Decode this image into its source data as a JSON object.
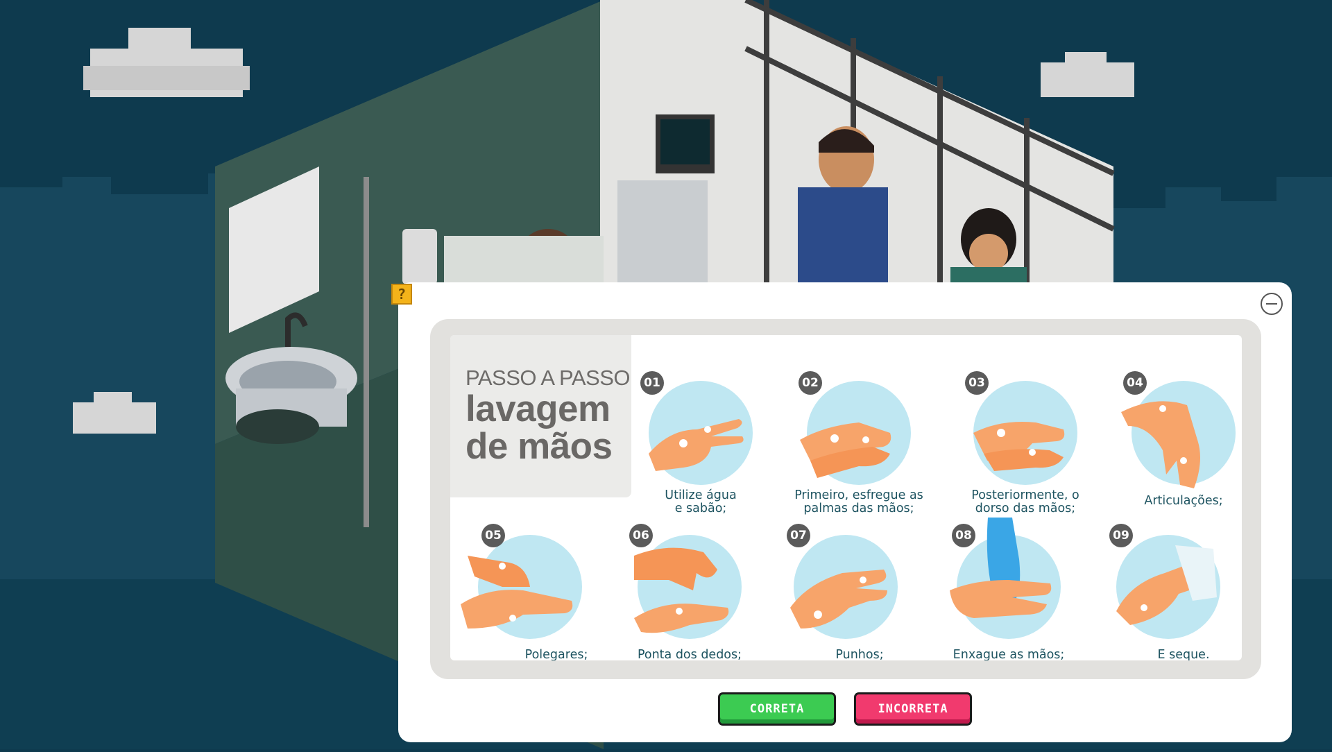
{
  "poster": {
    "title_small": "PASSO A PASSO",
    "title_big_line1": "lavagem",
    "title_big_line2": "de mãos"
  },
  "steps": [
    {
      "num": "01",
      "label_line1": "Utilize água",
      "label_line2": "e sabão;"
    },
    {
      "num": "02",
      "label_line1": "Primeiro, esfregue as",
      "label_line2": "palmas das mãos;"
    },
    {
      "num": "03",
      "label_line1": "Posteriormente, o",
      "label_line2": "dorso das mãos;"
    },
    {
      "num": "04",
      "label_line1": "Articulações;",
      "label_line2": ""
    },
    {
      "num": "05",
      "label_line1": "Polegares;",
      "label_line2": ""
    },
    {
      "num": "06",
      "label_line1": "Ponta dos dedos;",
      "label_line2": ""
    },
    {
      "num": "07",
      "label_line1": "Punhos;",
      "label_line2": ""
    },
    {
      "num": "08",
      "label_line1": "Enxague as mãos;",
      "label_line2": ""
    },
    {
      "num": "09",
      "label_line1": "E seque.",
      "label_line2": ""
    }
  ],
  "buttons": {
    "correct": "CORRETA",
    "incorrect": "INCORRETA"
  },
  "help_icon": "?",
  "colors": {
    "background_sky": "#0e3a4e",
    "circle_bg": "#bfe7f2",
    "skin": "#f7a46a",
    "correct": "#3ccb52",
    "incorrect": "#f13a6e",
    "help": "#f4b31a"
  },
  "icons": [
    "help-icon",
    "minimize-icon"
  ]
}
